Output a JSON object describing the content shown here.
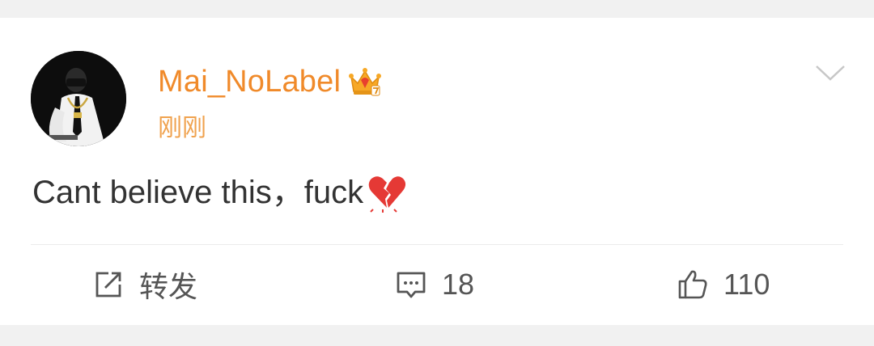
{
  "post": {
    "author": {
      "username": "Mai_NoLabel",
      "avatar_icon": "avatar-icon",
      "badge_icon": "crown-badge-icon"
    },
    "timestamp": "刚刚",
    "text": "Cant believe this，fuck",
    "emoji_icon": "broken-heart-icon",
    "menu_icon": "chevron-down-icon"
  },
  "actions": {
    "repost": {
      "label": "转发",
      "icon": "share-icon"
    },
    "comment": {
      "count": "18",
      "icon": "comment-icon"
    },
    "like": {
      "count": "110",
      "icon": "thumbs-up-icon"
    }
  },
  "colors": {
    "username": "#f08a2a",
    "timestamp": "#f0a24e",
    "text": "#333333",
    "action_text": "#555555",
    "background": "#f1f1f1",
    "card": "#ffffff"
  }
}
